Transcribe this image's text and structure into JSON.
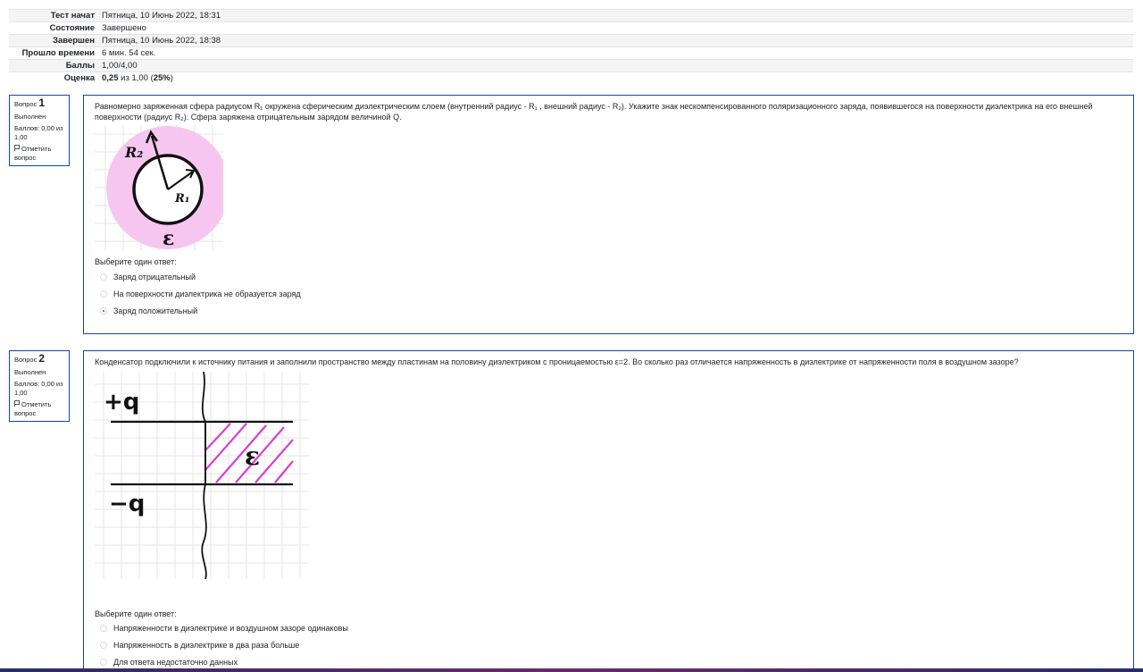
{
  "summary": {
    "rows": [
      {
        "label": "Тест начат",
        "value": "Пятница, 10 Июнь 2022, 18:31"
      },
      {
        "label": "Состояние",
        "value": "Завершено"
      },
      {
        "label": "Завершен",
        "value": "Пятница, 10 Июнь 2022, 18:38"
      },
      {
        "label": "Прошло времени",
        "value": "6 мин. 54 сек."
      },
      {
        "label": "Баллы",
        "value": "1,00/4,00"
      }
    ],
    "grade_label": "Оценка",
    "grade_value": "0,25",
    "grade_of": " из 1,00 (",
    "grade_pct": "25%",
    "grade_close": ")"
  },
  "questions": [
    {
      "label": "Вопрос ",
      "number": "1",
      "state": "Выполнен",
      "grade": "Баллов: 0,00 из 1,00",
      "flag": "Отметить вопрос",
      "text": "Равномерно заряженная сфера радиусом R₁ окружена сферическим диэлектрическим слоем (внутренний радиус - R₁ , внешний радиус - R₂).  Укажите знак нескомпенсированного поляризационного заряда, появившегося на поверхности диэлектрика на его внешней поверхности (радиус R₂). Сфера заряжена отрицательным зарядом величиной Q.",
      "figure": {
        "r2": "R₂",
        "r1": "R₁",
        "eps": "ε"
      },
      "prompt": "Выберите один ответ:",
      "options": [
        {
          "label": "Заряд отрицательный",
          "checked": false
        },
        {
          "label": "На поверхности диэлектрика не образуется заряд",
          "checked": false
        },
        {
          "label": "Заряд положительный",
          "checked": true
        }
      ]
    },
    {
      "label": "Вопрос ",
      "number": "2",
      "state": "Выполнен",
      "grade": "Баллов: 0,00 из 1,00",
      "flag": "Отметить вопрос",
      "text": "Конденсатор подключили к источнику питания и заполнили пространство между пластинам на половину диэлектриком с проницаемостью ε=2. Во сколько раз отличается напряженность в диэлектрике от напряженности поля в воздушном зазоре?",
      "figure": {
        "plus": "+q",
        "minus": "−q",
        "eps": "ε"
      },
      "prompt": "Выберите один ответ:",
      "options": [
        {
          "label": "Напряженности в диэлектрике и воздушном зазоре одинаковы",
          "checked": false
        },
        {
          "label": "Напряженность в диэлектрике в два раза больше",
          "checked": false
        },
        {
          "label": "Для ответа недостаточно данных",
          "checked": false
        }
      ]
    }
  ],
  "colors": {
    "accent": "#0f47ad",
    "dielectric": "#f6c6f0",
    "hatch": "#d63fd0"
  }
}
